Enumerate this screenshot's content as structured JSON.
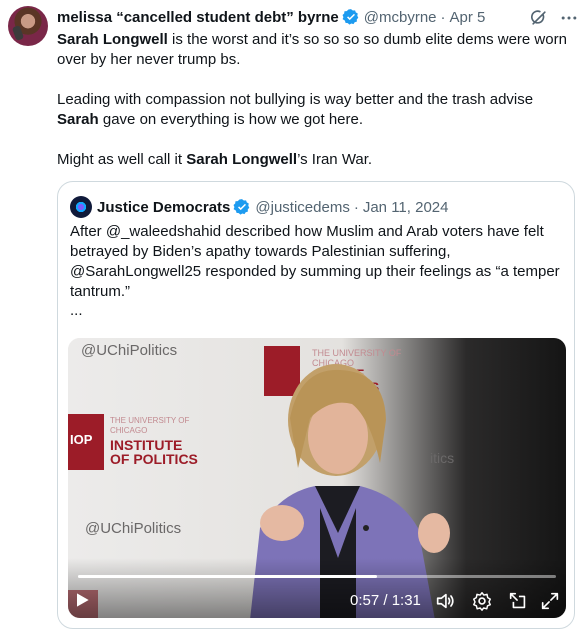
{
  "tweet": {
    "author_name": "melissa “cancelled student debt” byrne",
    "handle": "@mcbyrne",
    "separator": "·",
    "date": "Apr 5",
    "paragraph1_bold1": "Sarah Longwell",
    "paragraph1_rest": " is the worst and it’s so so so so dumb elite dems were worn over by her never trump bs.",
    "paragraph2_pre": "Leading with compassion not bullying is way better and the trash advise ",
    "paragraph2_bold": "Sarah",
    "paragraph2_post": " gave on everything is how we got here.",
    "paragraph3_pre": "Might as well call it ",
    "paragraph3_bold": "Sarah Longwell",
    "paragraph3_post": "’s Iran War."
  },
  "quote": {
    "author_name": "Justice Democrats",
    "handle": "@justicedems",
    "separator": "·",
    "date": "Jan 11, 2024",
    "text": "After @_waleedshahid described how Muslim and Arab voters have felt betrayed by Biden’s apathy towards Palestinian suffering, @SarahLongwell25 responded by summing up their feelings as “a temper tantrum.”",
    "more": "..."
  },
  "video": {
    "watermark_top": "@UChiPolitics",
    "watermark_bottom": "@UChiPolitics",
    "banner_univ": "THE UNIVERSITY OF CHICAGO",
    "banner_iop": "IOP",
    "banner_institute": "INSTITUTE",
    "banner_politics": "OF POLITICS",
    "banner2_politics": "ITUTE\nOLITICS",
    "banner_tics": "itics",
    "time": "0:57 / 1:31",
    "progress": 0.626
  },
  "icons": {
    "verified": "verified-badge-icon",
    "grok": "grok-icon",
    "more": "more-icon",
    "play": "play-icon",
    "volume": "volume-icon",
    "settings": "settings-icon",
    "popout": "popout-icon",
    "fullscreen": "fullscreen-icon"
  },
  "colors": {
    "verified_blue": "#1d9bf0",
    "text": "#0f1419",
    "secondary": "#536471",
    "border": "#cfd9de",
    "banner_red": "#9c1c28"
  }
}
